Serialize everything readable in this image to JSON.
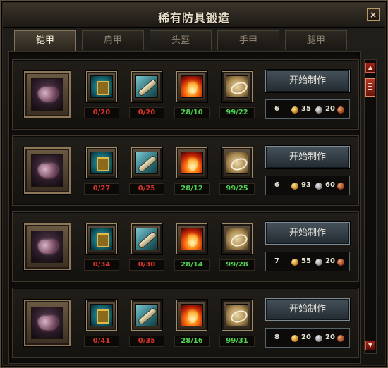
{
  "window": {
    "title": "稀有防具锻造",
    "close_glyph": "×"
  },
  "tabs": [
    {
      "label": "铠甲",
      "active": true
    },
    {
      "label": "肩甲",
      "active": false
    },
    {
      "label": "头盔",
      "active": false
    },
    {
      "label": "手甲",
      "active": false
    },
    {
      "label": "腿甲",
      "active": false
    }
  ],
  "craft_label": "开始制作",
  "recipes": [
    {
      "portrait_icon": "armor-portrait",
      "materials": [
        {
          "icon": "tablet-icon",
          "count": "0/20",
          "status": "insufficient"
        },
        {
          "icon": "scroll-icon",
          "count": "0/20",
          "status": "insufficient"
        },
        {
          "icon": "flame-icon",
          "count": "28/10",
          "status": "sufficient"
        },
        {
          "icon": "parchment-icon",
          "count": "99/22",
          "status": "sufficient"
        }
      ],
      "cost": {
        "qty": "6",
        "gold": "35",
        "silver": "20"
      }
    },
    {
      "portrait_icon": "armor-portrait",
      "materials": [
        {
          "icon": "tablet-icon",
          "count": "0/27",
          "status": "insufficient"
        },
        {
          "icon": "scroll-icon",
          "count": "0/25",
          "status": "insufficient"
        },
        {
          "icon": "flame-icon",
          "count": "28/12",
          "status": "sufficient"
        },
        {
          "icon": "parchment-icon",
          "count": "99/25",
          "status": "sufficient"
        }
      ],
      "cost": {
        "qty": "6",
        "gold": "93",
        "silver": "60"
      }
    },
    {
      "portrait_icon": "armor-portrait",
      "materials": [
        {
          "icon": "tablet-icon",
          "count": "0/34",
          "status": "insufficient"
        },
        {
          "icon": "scroll-icon",
          "count": "0/30",
          "status": "insufficient"
        },
        {
          "icon": "flame-icon",
          "count": "28/14",
          "status": "sufficient"
        },
        {
          "icon": "parchment-icon",
          "count": "99/28",
          "status": "sufficient"
        }
      ],
      "cost": {
        "qty": "7",
        "gold": "55",
        "silver": "20"
      }
    },
    {
      "portrait_icon": "armor-portrait",
      "materials": [
        {
          "icon": "tablet-icon",
          "count": "0/41",
          "status": "insufficient"
        },
        {
          "icon": "scroll-icon",
          "count": "0/35",
          "status": "insufficient"
        },
        {
          "icon": "flame-icon",
          "count": "28/16",
          "status": "sufficient"
        },
        {
          "icon": "parchment-icon",
          "count": "99/31",
          "status": "sufficient"
        }
      ],
      "cost": {
        "qty": "8",
        "gold": "20",
        "silver": "20"
      }
    }
  ],
  "scrollbar": {
    "up_glyph": "▲",
    "down_glyph": "▼"
  },
  "colors": {
    "insufficient": "#e0342a",
    "sufficient": "#4fd04f",
    "frame_gold": "#a08b68"
  }
}
